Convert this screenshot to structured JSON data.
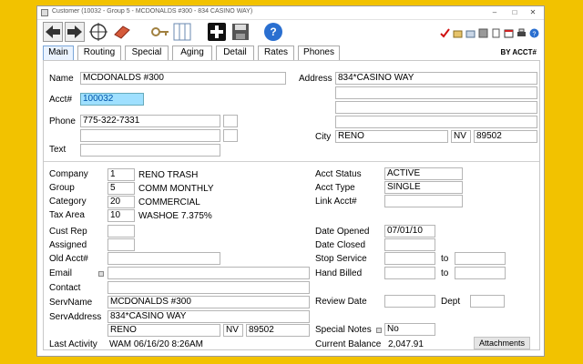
{
  "window": {
    "title": "Customer (10032 - Group 5 - MCDONALDS #300 - 834 CASINO WAY)"
  },
  "tabs": [
    {
      "label": "Main"
    },
    {
      "label": "Routing"
    },
    {
      "label": "Special"
    },
    {
      "label": "Aging"
    },
    {
      "label": "Detail"
    },
    {
      "label": "Rates"
    },
    {
      "label": "Phones"
    }
  ],
  "by_acct": "BY ACCT#",
  "top": {
    "name_label": "Name",
    "name": "MCDONALDS #300",
    "acct_label": "Acct#",
    "acct": "100032",
    "phone_label": "Phone",
    "phone": "775-322-7331",
    "text_label": "Text",
    "address_label": "Address",
    "address1": "834*CASINO WAY",
    "city_label": "City",
    "city": "RENO",
    "state": "NV",
    "zip": "89502"
  },
  "left": {
    "company_label": "Company",
    "company_code": "1",
    "company_name": "RENO TRASH",
    "group_label": "Group",
    "group_code": "5",
    "group_name": "COMM MONTHLY",
    "category_label": "Category",
    "category_code": "20",
    "category_name": "COMMERCIAL",
    "taxarea_label": "Tax Area",
    "taxarea_code": "10",
    "taxarea_name": "WASHOE 7.375%",
    "custrep_label": "Cust Rep",
    "assigned_label": "Assigned",
    "oldacct_label": "Old Acct#",
    "email_label": "Email",
    "contact_label": "Contact",
    "servname_label": "ServName",
    "servname": "MCDONALDS #300",
    "servaddress_label": "ServAddress",
    "servaddress": "834*CASINO WAY",
    "servcity": "RENO",
    "servstate": "NV",
    "servzip": "89502",
    "lastactivity_label": "Last Activity",
    "lastactivity": "WAM 06/16/20  8:26AM"
  },
  "right": {
    "acctstatus_label": "Acct Status",
    "acctstatus": "ACTIVE",
    "accttype_label": "Acct Type",
    "accttype": "SINGLE",
    "linkacct_label": "Link Acct#",
    "dateopened_label": "Date Opened",
    "dateopened": "07/01/10",
    "dateclosed_label": "Date Closed",
    "stopservice_label": "Stop Service",
    "to_label": "to",
    "handbilled_label": "Hand Billed",
    "to2_label": "to",
    "reviewdate_label": "Review Date",
    "dept_label": "Dept",
    "specialnotes_label": "Special Notes",
    "specialnotes": "No",
    "balance_label": "Current Balance",
    "balance": "2,047.91",
    "attachments_label": "Attachments"
  },
  "colors": {
    "accent": "#9fe0ff",
    "tab_active": "#eaf3ff",
    "background": "#f2c200"
  }
}
